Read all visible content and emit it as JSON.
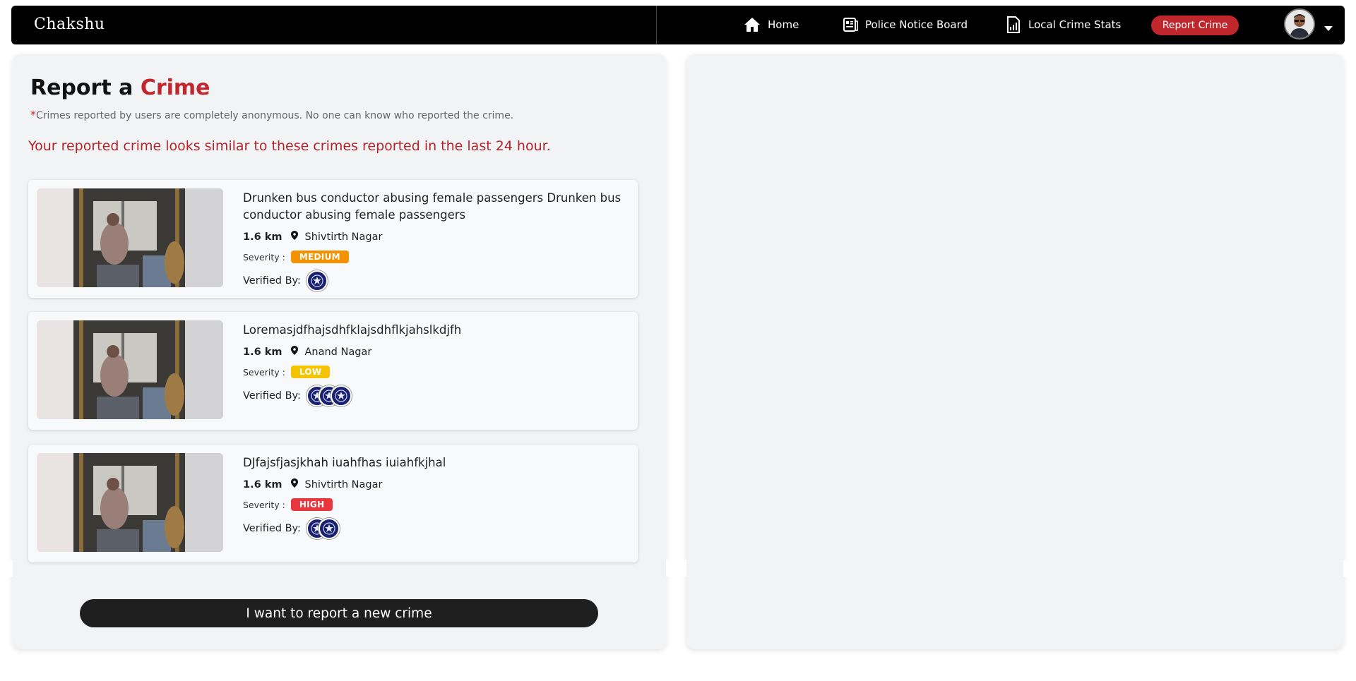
{
  "navbar": {
    "brand": "Chakshu",
    "items": [
      {
        "label": "Home",
        "icon": "home-icon"
      },
      {
        "label": "Police Notice Board",
        "icon": "notice-board-icon"
      },
      {
        "label": "Local Crime Stats",
        "icon": "stats-icon"
      }
    ],
    "report_button": "Report Crime",
    "avatar_icon": "user-avatar",
    "menu_icon": "caret-down-icon"
  },
  "report": {
    "title_prefix": "Report a",
    "title_accent": "Crime",
    "note_mark": "*",
    "note": "Crimes reported by users are completely anonymous. No one can know who reported the crime.",
    "similar_heading": "Your reported crime looks similar to these crimes reported in the last 24 hour."
  },
  "crimes": [
    {
      "title": "Drunken bus conductor abusing female passengers Drunken bus conductor abusing female passengers",
      "distance": "1.6 km",
      "location": "Shivtirth Nagar",
      "severity_label": "Severity :",
      "severity": "MEDIUM",
      "severity_color": "#f39200",
      "verified_label": "Verified By:",
      "verifier_count": 1
    },
    {
      "title": "Loremasjdfhajsdhfklajsdhflkjahslkdjfh",
      "distance": "1.6 km",
      "location": "Anand Nagar",
      "severity_label": "Severity :",
      "severity": "LOW",
      "severity_color": "#f5c400",
      "verified_label": "Verified By:",
      "verifier_count": 3
    },
    {
      "title": "DJfajsfjasjkhah iuahfhas iuiahfkjhal",
      "distance": "1.6 km",
      "location": "Shivtirth Nagar",
      "severity_label": "Severity :",
      "severity": "HIGH",
      "severity_color": "#e8363c",
      "verified_label": "Verified By:",
      "verifier_count": 2
    }
  ],
  "cta_label": "I want to report a new crime"
}
